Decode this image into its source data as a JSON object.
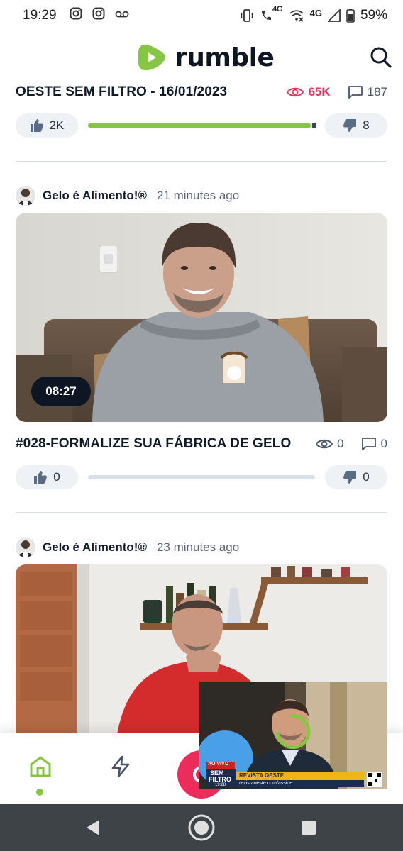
{
  "status_bar": {
    "time": "19:29",
    "battery": "59%",
    "network_1": "4G",
    "network_2": "4G",
    "icons": [
      "instagram-icon",
      "instagram-icon",
      "voicemail-icon",
      "vibrate-icon",
      "wifi-calling-icon",
      "wifi-off-icon",
      "signal-icon",
      "battery-icon"
    ]
  },
  "header": {
    "logo_text": "rumble",
    "brand_color": "#85c742",
    "search_icon": "search-icon"
  },
  "posts": [
    {
      "title": "OESTE SEM FILTRO - 16/01/2023",
      "views": "65K",
      "comments": "187",
      "likes": "2K",
      "dislikes": "8",
      "like_ratio": 0.98
    },
    {
      "channel": "Gelo é Alimento!®",
      "time_ago": "21 minutes ago",
      "duration": "08:27",
      "title": "#028-FORMALIZE SUA FÁBRICA DE GELO",
      "views": "0",
      "comments": "0",
      "likes": "0",
      "dislikes": "0",
      "like_ratio": 0
    },
    {
      "channel": "Gelo é Alimento!®",
      "time_ago": "23 minutes ago"
    }
  ],
  "pip": {
    "live_label": "AO VIVO",
    "show_name_1": "SEM",
    "show_name_2": "FILTRO",
    "network": "REVISTA OESTE",
    "clock": "19:28",
    "url": "revistaoeste.com/assine"
  },
  "bottom_nav": {
    "items": [
      "home-icon",
      "lightning-icon",
      "live-icon"
    ],
    "active": "home",
    "active_color": "#85c742",
    "live_color": "#ec2d5c"
  },
  "android_nav": [
    "back-icon",
    "home-circle-icon",
    "recents-icon"
  ]
}
